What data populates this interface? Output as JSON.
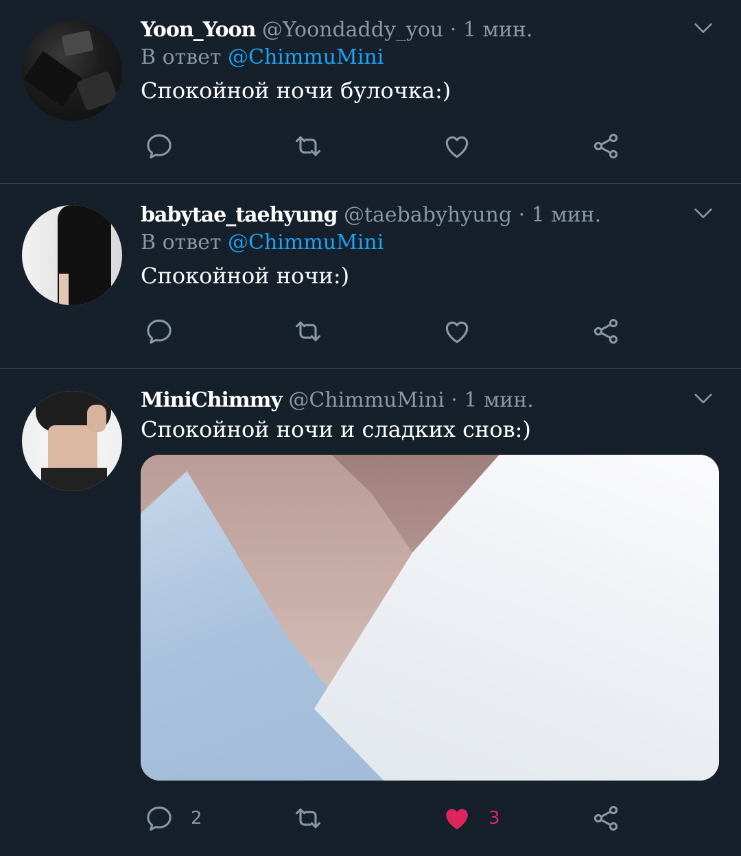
{
  "tweets": [
    {
      "name": "Yoon_Yoon",
      "handle": "@Yoondaddy_you",
      "time": "· 1 мин.",
      "reply_prefix": "В ответ",
      "reply_to": "@ChimmuMini",
      "text": "Спокойной ночи булочка:)"
    },
    {
      "name": "babytae_taehyung",
      "handle": "@taebabyhyung",
      "time": "· 1 мин.",
      "reply_prefix": "В ответ",
      "reply_to": "@ChimmuMini",
      "text": "Спокойной ночи:)"
    },
    {
      "name": "MiniChimmy",
      "handle": "@ChimmuMini",
      "time": "· 1 мин.",
      "text": "Спокойной ночи и сладких снов:)",
      "reply_count": "2",
      "like_count": "3",
      "liked": true
    }
  ],
  "colors": {
    "background": "#15202b",
    "divider": "#38444d",
    "secondary_text": "#8899a6",
    "mention": "#1da1f2",
    "like_active": "#e0245e"
  },
  "icons": {
    "reply": "reply-icon",
    "retweet": "retweet-icon",
    "like": "heart-icon",
    "share": "share-icon",
    "more": "chevron-down-icon"
  }
}
